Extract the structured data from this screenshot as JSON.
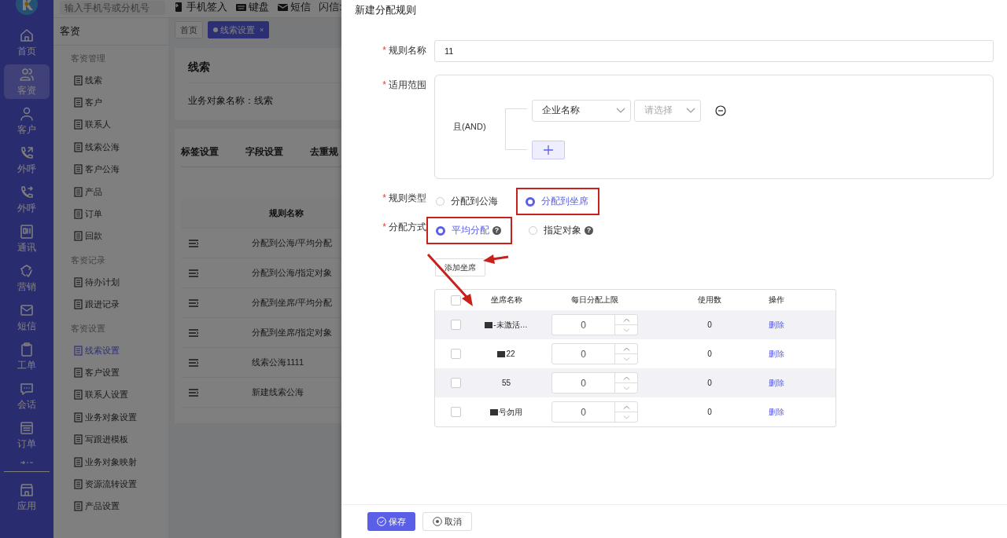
{
  "topbar": {
    "search_placeholder": "输入手机号或分机号",
    "actions": [
      "手机签入",
      "键盘",
      "短信"
    ],
    "flash_label": "闪信:"
  },
  "nav_rail": [
    {
      "label": "首页",
      "selected": false
    },
    {
      "label": "客资",
      "selected": true
    },
    {
      "label": "客户",
      "selected": false
    },
    {
      "label": "外呼",
      "selected": false
    },
    {
      "label": "外呼",
      "selected": false
    },
    {
      "label": "通讯",
      "selected": false
    },
    {
      "label": "营销",
      "selected": false
    },
    {
      "label": "短信",
      "selected": false
    },
    {
      "label": "工单",
      "selected": false
    },
    {
      "label": "会话",
      "selected": false
    },
    {
      "label": "订单",
      "selected": false
    },
    {
      "label": "应用",
      "selected": false
    }
  ],
  "sidebar": {
    "title": "客资",
    "groups": [
      {
        "heading": "客资管理",
        "items": [
          {
            "label": "线索",
            "selected": false
          },
          {
            "label": "客户",
            "selected": false
          },
          {
            "label": "联系人",
            "selected": false
          },
          {
            "label": "线索公海",
            "selected": false
          },
          {
            "label": "客户公海",
            "selected": false
          },
          {
            "label": "产品",
            "selected": false
          },
          {
            "label": "订单",
            "selected": false
          },
          {
            "label": "回款",
            "selected": false
          }
        ]
      },
      {
        "heading": "客资记录",
        "items": [
          {
            "label": "待办计划",
            "selected": false
          },
          {
            "label": "跟进记录",
            "selected": false
          }
        ]
      },
      {
        "heading": "客资设置",
        "items": [
          {
            "label": "线索设置",
            "selected": true
          },
          {
            "label": "客户设置",
            "selected": false
          },
          {
            "label": "联系人设置",
            "selected": false
          },
          {
            "label": "业务对象设置",
            "selected": false
          },
          {
            "label": "写跟进模板",
            "selected": false
          },
          {
            "label": "业务对象映射",
            "selected": false
          },
          {
            "label": "资源流转设置",
            "selected": false
          },
          {
            "label": "产品设置",
            "selected": false
          }
        ]
      }
    ]
  },
  "page_tabs": [
    {
      "label": "首页",
      "selected": false
    },
    {
      "label": "线索设置",
      "selected": true,
      "close": "×"
    }
  ],
  "content": {
    "title": "线索",
    "object_name": "业务对象名称：线索",
    "tabs": [
      "标签设置",
      "字段设置",
      "去重规"
    ],
    "column": "规则名称",
    "rows": [
      "分配到公海/平均分配",
      "分配到公海/指定对象",
      "分配到坐席/平均分配",
      "分配到坐席/指定对象",
      "线索公海1111",
      "新建线索公海"
    ]
  },
  "drawer": {
    "title": "新建分配规则",
    "rule_name": {
      "label": "规则名称",
      "required_mark": "*",
      "value": "11"
    },
    "scope": {
      "label": "适用范围",
      "required_mark": "*",
      "logic": "且(AND)",
      "conditions": [
        {
          "field": "企业名称",
          "operator_placeholder": "请选择"
        }
      ]
    },
    "rule_type": {
      "label": "规则类型",
      "required_mark": "*",
      "options": [
        {
          "label": "分配到公海",
          "selected": false,
          "highlighted": false
        },
        {
          "label": "分配到坐席",
          "selected": true,
          "highlighted": true
        }
      ]
    },
    "method": {
      "label": "分配方式",
      "required_mark": "*",
      "options": [
        {
          "label": "平均分配",
          "selected": true,
          "highlighted": true,
          "help": "?"
        },
        {
          "label": "指定对象",
          "selected": false,
          "highlighted": false,
          "help": "?"
        }
      ]
    },
    "add_button": "添加坐席",
    "seats": {
      "columns": [
        "坐席名称",
        "每日分配上限",
        "使用数",
        "操作"
      ],
      "header_checked": false,
      "rows": [
        {
          "checked": false,
          "redacted": true,
          "name": "-未激活…",
          "limit": "0",
          "used": "0",
          "action": "删除"
        },
        {
          "checked": false,
          "redacted": true,
          "name": "22",
          "limit": "0",
          "used": "0",
          "action": "删除"
        },
        {
          "checked": false,
          "redacted": false,
          "name": "55",
          "limit": "0",
          "used": "0",
          "action": "删除"
        },
        {
          "checked": false,
          "redacted": true,
          "name": "号勿用",
          "limit": "0",
          "used": "0",
          "action": "删除"
        }
      ]
    },
    "footer": {
      "save": "保存",
      "cancel": "取消"
    }
  }
}
